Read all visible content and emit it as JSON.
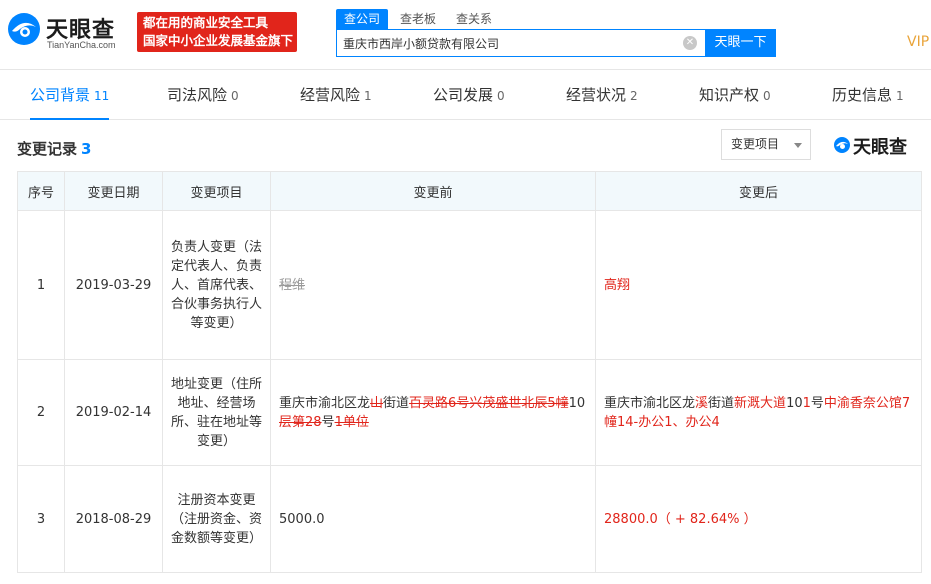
{
  "header": {
    "logo_cn": "天眼查",
    "logo_en": "TianYanCha.com",
    "slogan_line1": "都在用的商业安全工具",
    "slogan_line2": "国家中小企业发展基金旗下",
    "search_tabs": [
      "查公司",
      "查老板",
      "查关系"
    ],
    "search_value": "重庆市西岸小额贷款有限公司",
    "search_button": "天眼一下",
    "vip": "VIP"
  },
  "nav": [
    {
      "label": "公司背景",
      "count": "11"
    },
    {
      "label": "司法风险",
      "count": "0"
    },
    {
      "label": "经营风险",
      "count": "1"
    },
    {
      "label": "公司发展",
      "count": "0"
    },
    {
      "label": "经营状况",
      "count": "2"
    },
    {
      "label": "知识产权",
      "count": "0"
    },
    {
      "label": "历史信息",
      "count": "1"
    }
  ],
  "section": {
    "title": "变更记录",
    "count": "3",
    "filter_label": "变更项目",
    "watermark": "天眼查"
  },
  "table": {
    "headers": [
      "序号",
      "变更日期",
      "变更项目",
      "变更前",
      "变更后"
    ],
    "rows": [
      {
        "index": "1",
        "date": "2019-03-29",
        "item": "负责人变更（法定代表人、负责人、首席代表、合伙事务执行人等变更）",
        "before": [
          {
            "text": "程维",
            "style": "strike-grey"
          }
        ],
        "after": [
          {
            "text": "高翔",
            "style": "red"
          }
        ]
      },
      {
        "index": "2",
        "date": "2019-02-14",
        "item": "地址变更（住所地址、经营场所、驻在地址等变更）",
        "before": [
          {
            "text": "重庆市渝北区龙",
            "style": ""
          },
          {
            "text": "山",
            "style": "del"
          },
          {
            "text": "街道",
            "style": ""
          },
          {
            "text": "百灵路6号兴茂盛世北辰5幢",
            "style": "del"
          },
          {
            "text": "10",
            "style": ""
          },
          {
            "text": "层第28",
            "style": "del"
          },
          {
            "text": "号",
            "style": ""
          },
          {
            "text": "1单位",
            "style": "del"
          }
        ],
        "after": [
          {
            "text": "重庆市渝北区龙",
            "style": ""
          },
          {
            "text": "溪",
            "style": "red"
          },
          {
            "text": "街道",
            "style": ""
          },
          {
            "text": "新溉大道",
            "style": "red"
          },
          {
            "text": "10",
            "style": ""
          },
          {
            "text": "1",
            "style": "red"
          },
          {
            "text": "号",
            "style": ""
          },
          {
            "text": "中渝香奈公馆7幢14-办公1、办公4",
            "style": "red"
          }
        ]
      },
      {
        "index": "3",
        "date": "2018-08-29",
        "item": "注册资本变更（注册资金、资金数额等变更）",
        "before": [
          {
            "text": "5000.0",
            "style": ""
          }
        ],
        "after": [
          {
            "text": "28800.0（ + 82.64% ）",
            "style": "red"
          }
        ]
      }
    ]
  }
}
